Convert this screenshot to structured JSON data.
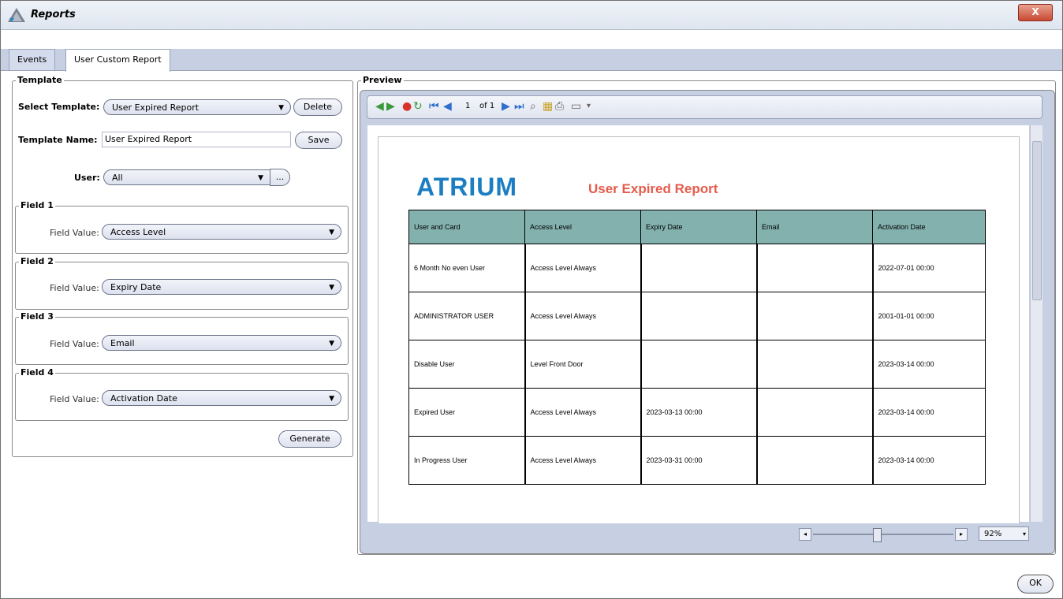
{
  "window": {
    "title": "Reports",
    "close_label": "X"
  },
  "tabs": [
    {
      "label": "Events",
      "active": false
    },
    {
      "label": "User Custom Report",
      "active": true
    }
  ],
  "template": {
    "group_title": "Template",
    "select_template_label": "Select Template:",
    "select_template_value": "User Expired Report",
    "delete_label": "Delete",
    "template_name_label": "Template Name:",
    "template_name_value": "User Expired Report",
    "save_label": "Save",
    "user_label": "User:",
    "user_value": "All",
    "user_browse_label": "...",
    "fields": [
      {
        "title": "Field 1",
        "label": "Field Value:",
        "value": "Access Level"
      },
      {
        "title": "Field 2",
        "label": "Field Value:",
        "value": "Expiry Date"
      },
      {
        "title": "Field 3",
        "label": "Field Value:",
        "value": "Email"
      },
      {
        "title": "Field 4",
        "label": "Field Value:",
        "value": "Activation Date"
      }
    ],
    "generate_label": "Generate"
  },
  "preview": {
    "group_title": "Preview",
    "page_current": "1",
    "page_of": "of 1",
    "zoom": "92%",
    "report": {
      "logo": "ATRIUM",
      "title": "User Expired Report",
      "columns": [
        "User and Card",
        "Access Level",
        "Expiry Date",
        "Email",
        "Activation Date"
      ],
      "rows": [
        [
          "6 Month No even User",
          "Access Level Always",
          "",
          "",
          "2022-07-01 00:00"
        ],
        [
          "ADMINISTRATOR USER",
          "Access Level Always",
          "",
          "",
          "2001-01-01 00:00"
        ],
        [
          "Disable User",
          "Level Front Door",
          "",
          "",
          "2023-03-14 00:00"
        ],
        [
          "Expired User",
          "Access Level Always",
          "2023-03-13 00:00",
          "",
          "2023-03-14 00:00"
        ],
        [
          "In Progress User",
          "Access Level Always",
          "2023-03-31 00:00",
          "",
          "2023-03-14 00:00"
        ]
      ]
    }
  },
  "ok_label": "OK",
  "colors": {
    "header_fill": "#83b1ad",
    "logo_blue": "#1b7ec2",
    "report_title_red": "#e55c4d"
  }
}
